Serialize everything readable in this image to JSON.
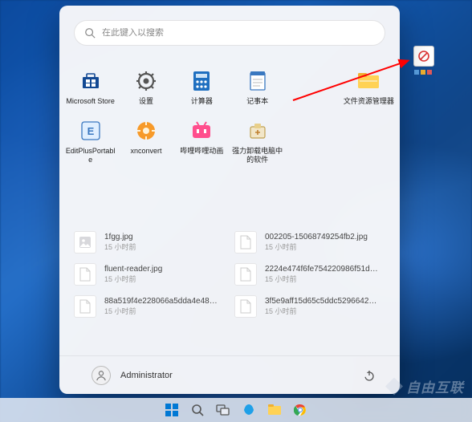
{
  "search": {
    "placeholder": "在此键入以搜索"
  },
  "pinned": [
    {
      "name": "Microsoft Store",
      "icon": "store"
    },
    {
      "name": "设置",
      "icon": "settings"
    },
    {
      "name": "计算器",
      "icon": "calculator"
    },
    {
      "name": "记事本",
      "icon": "notepad"
    },
    {
      "name": "",
      "icon": "blank"
    },
    {
      "name": "文件资源管理器",
      "icon": "explorer"
    },
    {
      "name": "EditPlusPortable",
      "icon": "editplus"
    },
    {
      "name": "xnconvert",
      "icon": "xnconvert"
    },
    {
      "name": "哔哩哔哩动画",
      "icon": "bilibili"
    },
    {
      "name": "强力卸载电脑中的软件",
      "icon": "uninstaller"
    }
  ],
  "recommended": [
    {
      "name": "1fgg.jpg",
      "time": "15 小时前",
      "icon": "image"
    },
    {
      "name": "002205-15068749254fb2.jpg",
      "time": "15 小时前",
      "icon": "file"
    },
    {
      "name": "fluent-reader.jpg",
      "time": "15 小时前",
      "icon": "file"
    },
    {
      "name": "2224e474f6fe754220986f51d22eaa...",
      "time": "15 小时前",
      "icon": "file"
    },
    {
      "name": "88a519f4e228066a5dda4e4868c4fe...",
      "time": "15 小时前",
      "icon": "file"
    },
    {
      "name": "3f5e9aff15d65c5ddc5296642edd67...",
      "time": "15 小时前",
      "icon": "file"
    }
  ],
  "user": {
    "name": "Administrator"
  },
  "desktop": {
    "shortcut": ""
  },
  "watermark": "自由互联",
  "colors": {
    "accent": "#0078d4",
    "arrow": "#ff0000"
  }
}
